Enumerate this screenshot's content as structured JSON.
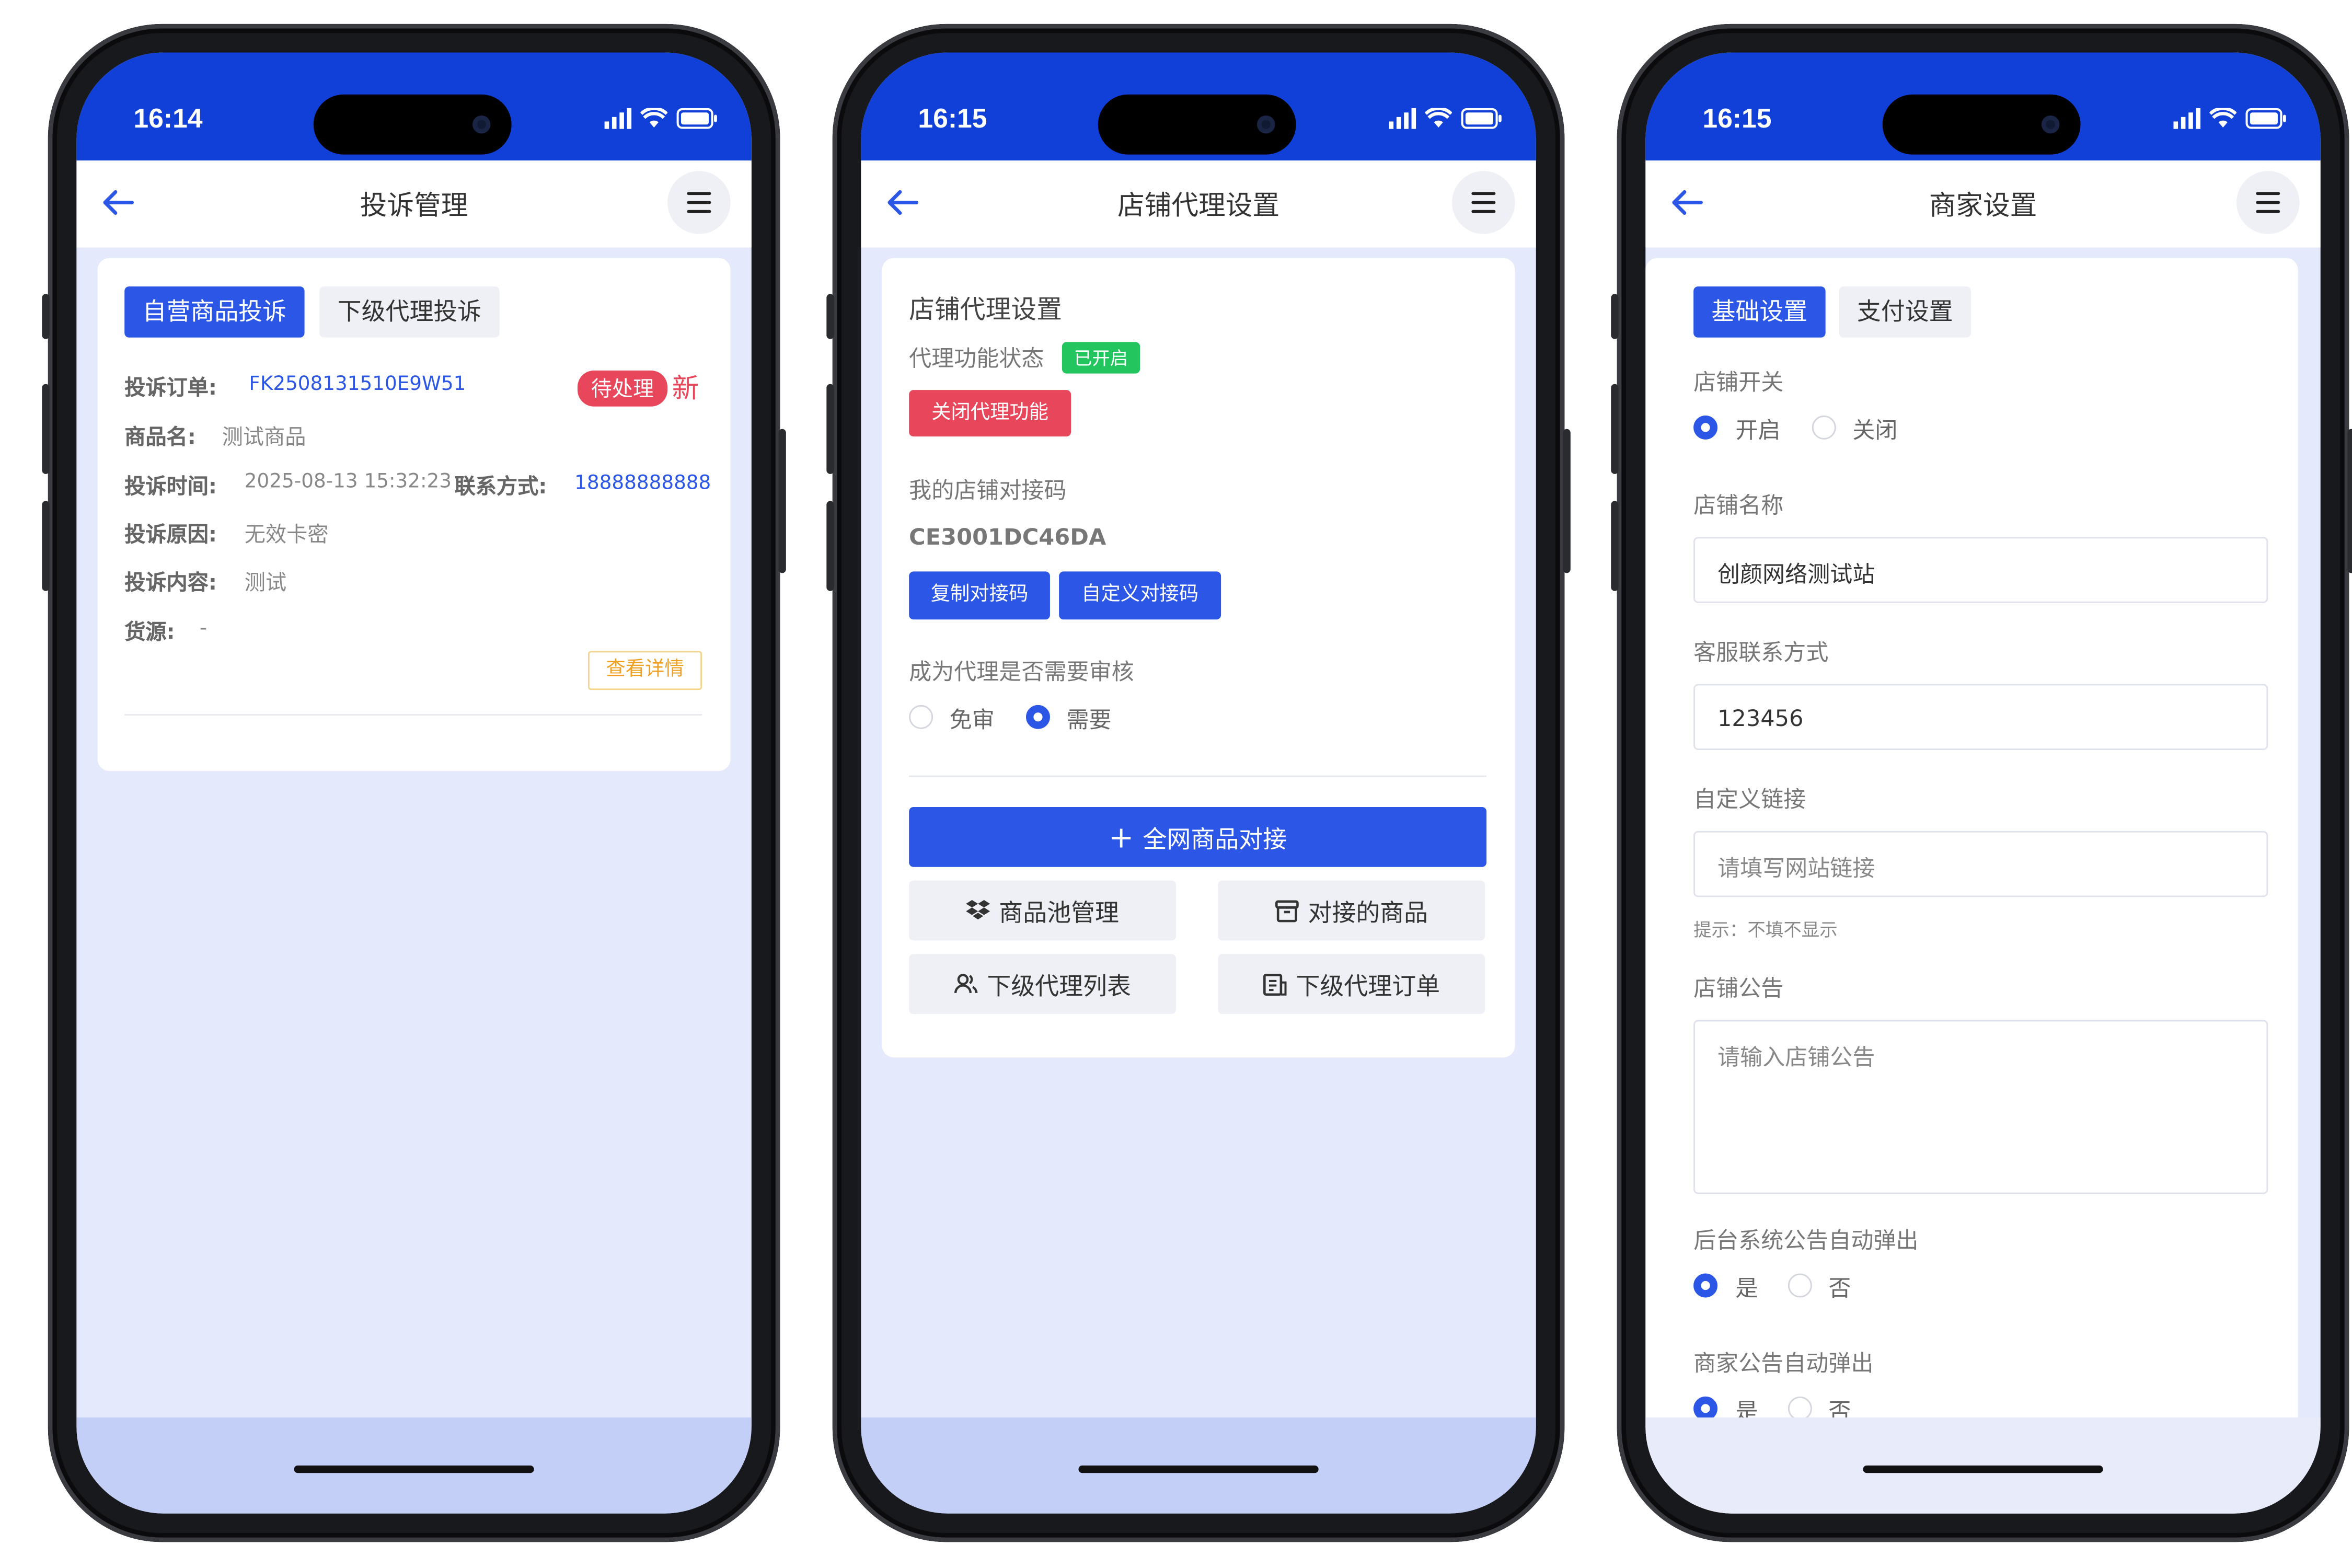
{
  "status_time_1": "16:14",
  "status_time_2": "16:15",
  "status_time_3": "16:15",
  "screen1": {
    "title": "投诉管理",
    "tabs": [
      "自营商品投诉",
      "下级代理投诉"
    ],
    "order_label": "投诉订单:",
    "order_no": "FK2508131510E9W51",
    "badge": "待处理",
    "new_tag": "新",
    "product_label": "商品名:",
    "product_value": "测试商品",
    "time_label": "投诉时间:",
    "time_value": "2025-08-13 15:32:23",
    "contact_label": "联系方式:",
    "contact_value": "18888888888",
    "reason_label": "投诉原因:",
    "reason_value": "无效卡密",
    "content_label": "投诉内容:",
    "content_value": "测试",
    "source_label": "货源:",
    "source_value": "-",
    "detail_button": "查看详情"
  },
  "screen2": {
    "title": "店铺代理设置",
    "card_title": "店铺代理设置",
    "status_label": "代理功能状态",
    "status_badge": "已开启",
    "close_button": "关闭代理功能",
    "code_label": "我的店铺对接码",
    "code_value": "CE3001DC46DA",
    "copy_button": "复制对接码",
    "custom_button": "自定义对接码",
    "review_label": "成为代理是否需要审核",
    "review_options": [
      "免审",
      "需要"
    ],
    "review_selected": "需要",
    "primary_button": "全网商品对接",
    "grid_buttons": [
      "商品池管理",
      "对接的商品",
      "下级代理列表",
      "下级代理订单"
    ]
  },
  "screen3": {
    "title": "商家设置",
    "tabs": [
      "基础设置",
      "支付设置"
    ],
    "switch_label": "店铺开关",
    "switch_options": [
      "开启",
      "关闭"
    ],
    "switch_selected": "开启",
    "name_label": "店铺名称",
    "name_value": "创颜网络测试站",
    "service_label": "客服联系方式",
    "service_value": "123456",
    "link_label": "自定义链接",
    "link_placeholder": "请填写网站链接",
    "link_hint": "提示：不填不显示",
    "notice_label": "店铺公告",
    "notice_placeholder": "请输入店铺公告",
    "sys_popup_label": "后台系统公告自动弹出",
    "sys_popup_options": [
      "是",
      "否"
    ],
    "sys_popup_selected": "是",
    "merchant_popup_label": "商家公告自动弹出",
    "merchant_popup_options": [
      "是",
      "否"
    ],
    "merchant_popup_selected": "是"
  },
  "colors": {
    "status_bar": "#1040d8",
    "primary": "#2b56e6",
    "page_bg": "#e4e9fb",
    "danger": "#e8475b",
    "success": "#22c55e",
    "warning": "#f5b73d"
  }
}
